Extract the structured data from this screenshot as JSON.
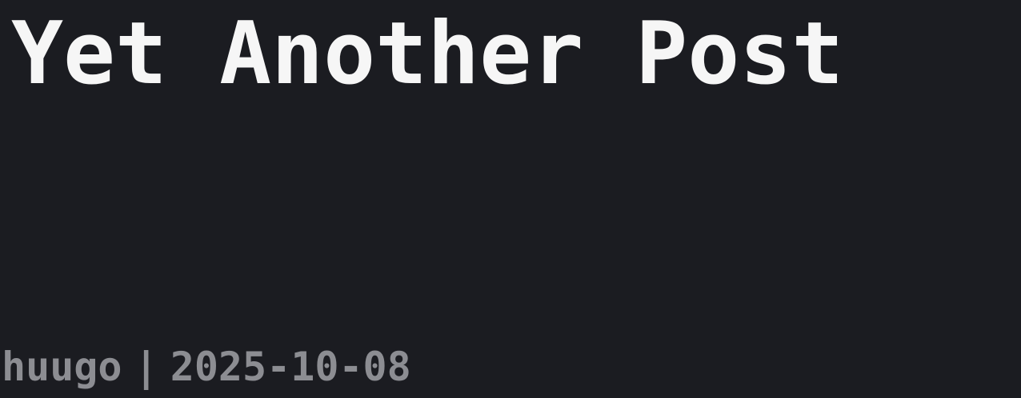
{
  "post": {
    "title": "Yet Another Post",
    "author": "huugo",
    "separator": "|",
    "date": "2025-10-08"
  },
  "colors": {
    "background": "#1b1c21",
    "title": "#f6f6f6",
    "meta": "#8c8d92"
  }
}
